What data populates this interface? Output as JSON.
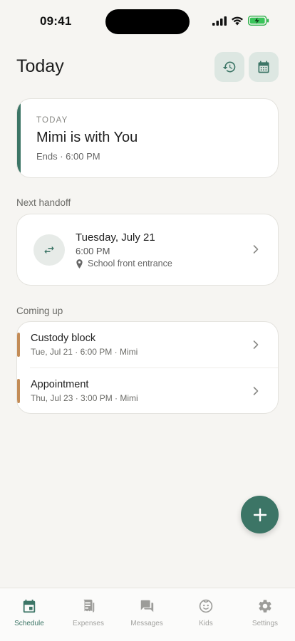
{
  "status_bar": {
    "time": "09:41"
  },
  "header": {
    "title": "Today",
    "history_icon": "history-icon",
    "calendar_icon": "calendar-icon"
  },
  "today_card": {
    "eyebrow": "TODAY",
    "headline": "Mimi is with You",
    "subtext": "Ends · 6:00 PM",
    "accent_color": "#3c7566"
  },
  "next_handoff": {
    "section_label": "Next handoff",
    "date": "Tuesday, July 21",
    "time": "6:00 PM",
    "location": "School front entrance"
  },
  "coming_up": {
    "section_label": "Coming up",
    "items": [
      {
        "title": "Custody block",
        "subtitle": "Tue, Jul 21 · 6:00 PM · Mimi",
        "color": "#c38c57"
      },
      {
        "title": "Appointment",
        "subtitle": "Thu, Jul 23 · 3:00 PM · Mimi",
        "color": "#c38c57"
      }
    ]
  },
  "fab": {
    "icon": "plus-icon"
  },
  "tab_bar": {
    "tabs": [
      {
        "label": "Schedule",
        "icon": "calendar-icon",
        "active": true
      },
      {
        "label": "Expenses",
        "icon": "receipt-icon",
        "active": false
      },
      {
        "label": "Messages",
        "icon": "chat-icon",
        "active": false
      },
      {
        "label": "Kids",
        "icon": "child-face-icon",
        "active": false
      },
      {
        "label": "Settings",
        "icon": "gear-icon",
        "active": false
      }
    ]
  },
  "colors": {
    "primary": "#3c7566",
    "event_accent": "#c38c57",
    "background": "#f6f5f2"
  }
}
